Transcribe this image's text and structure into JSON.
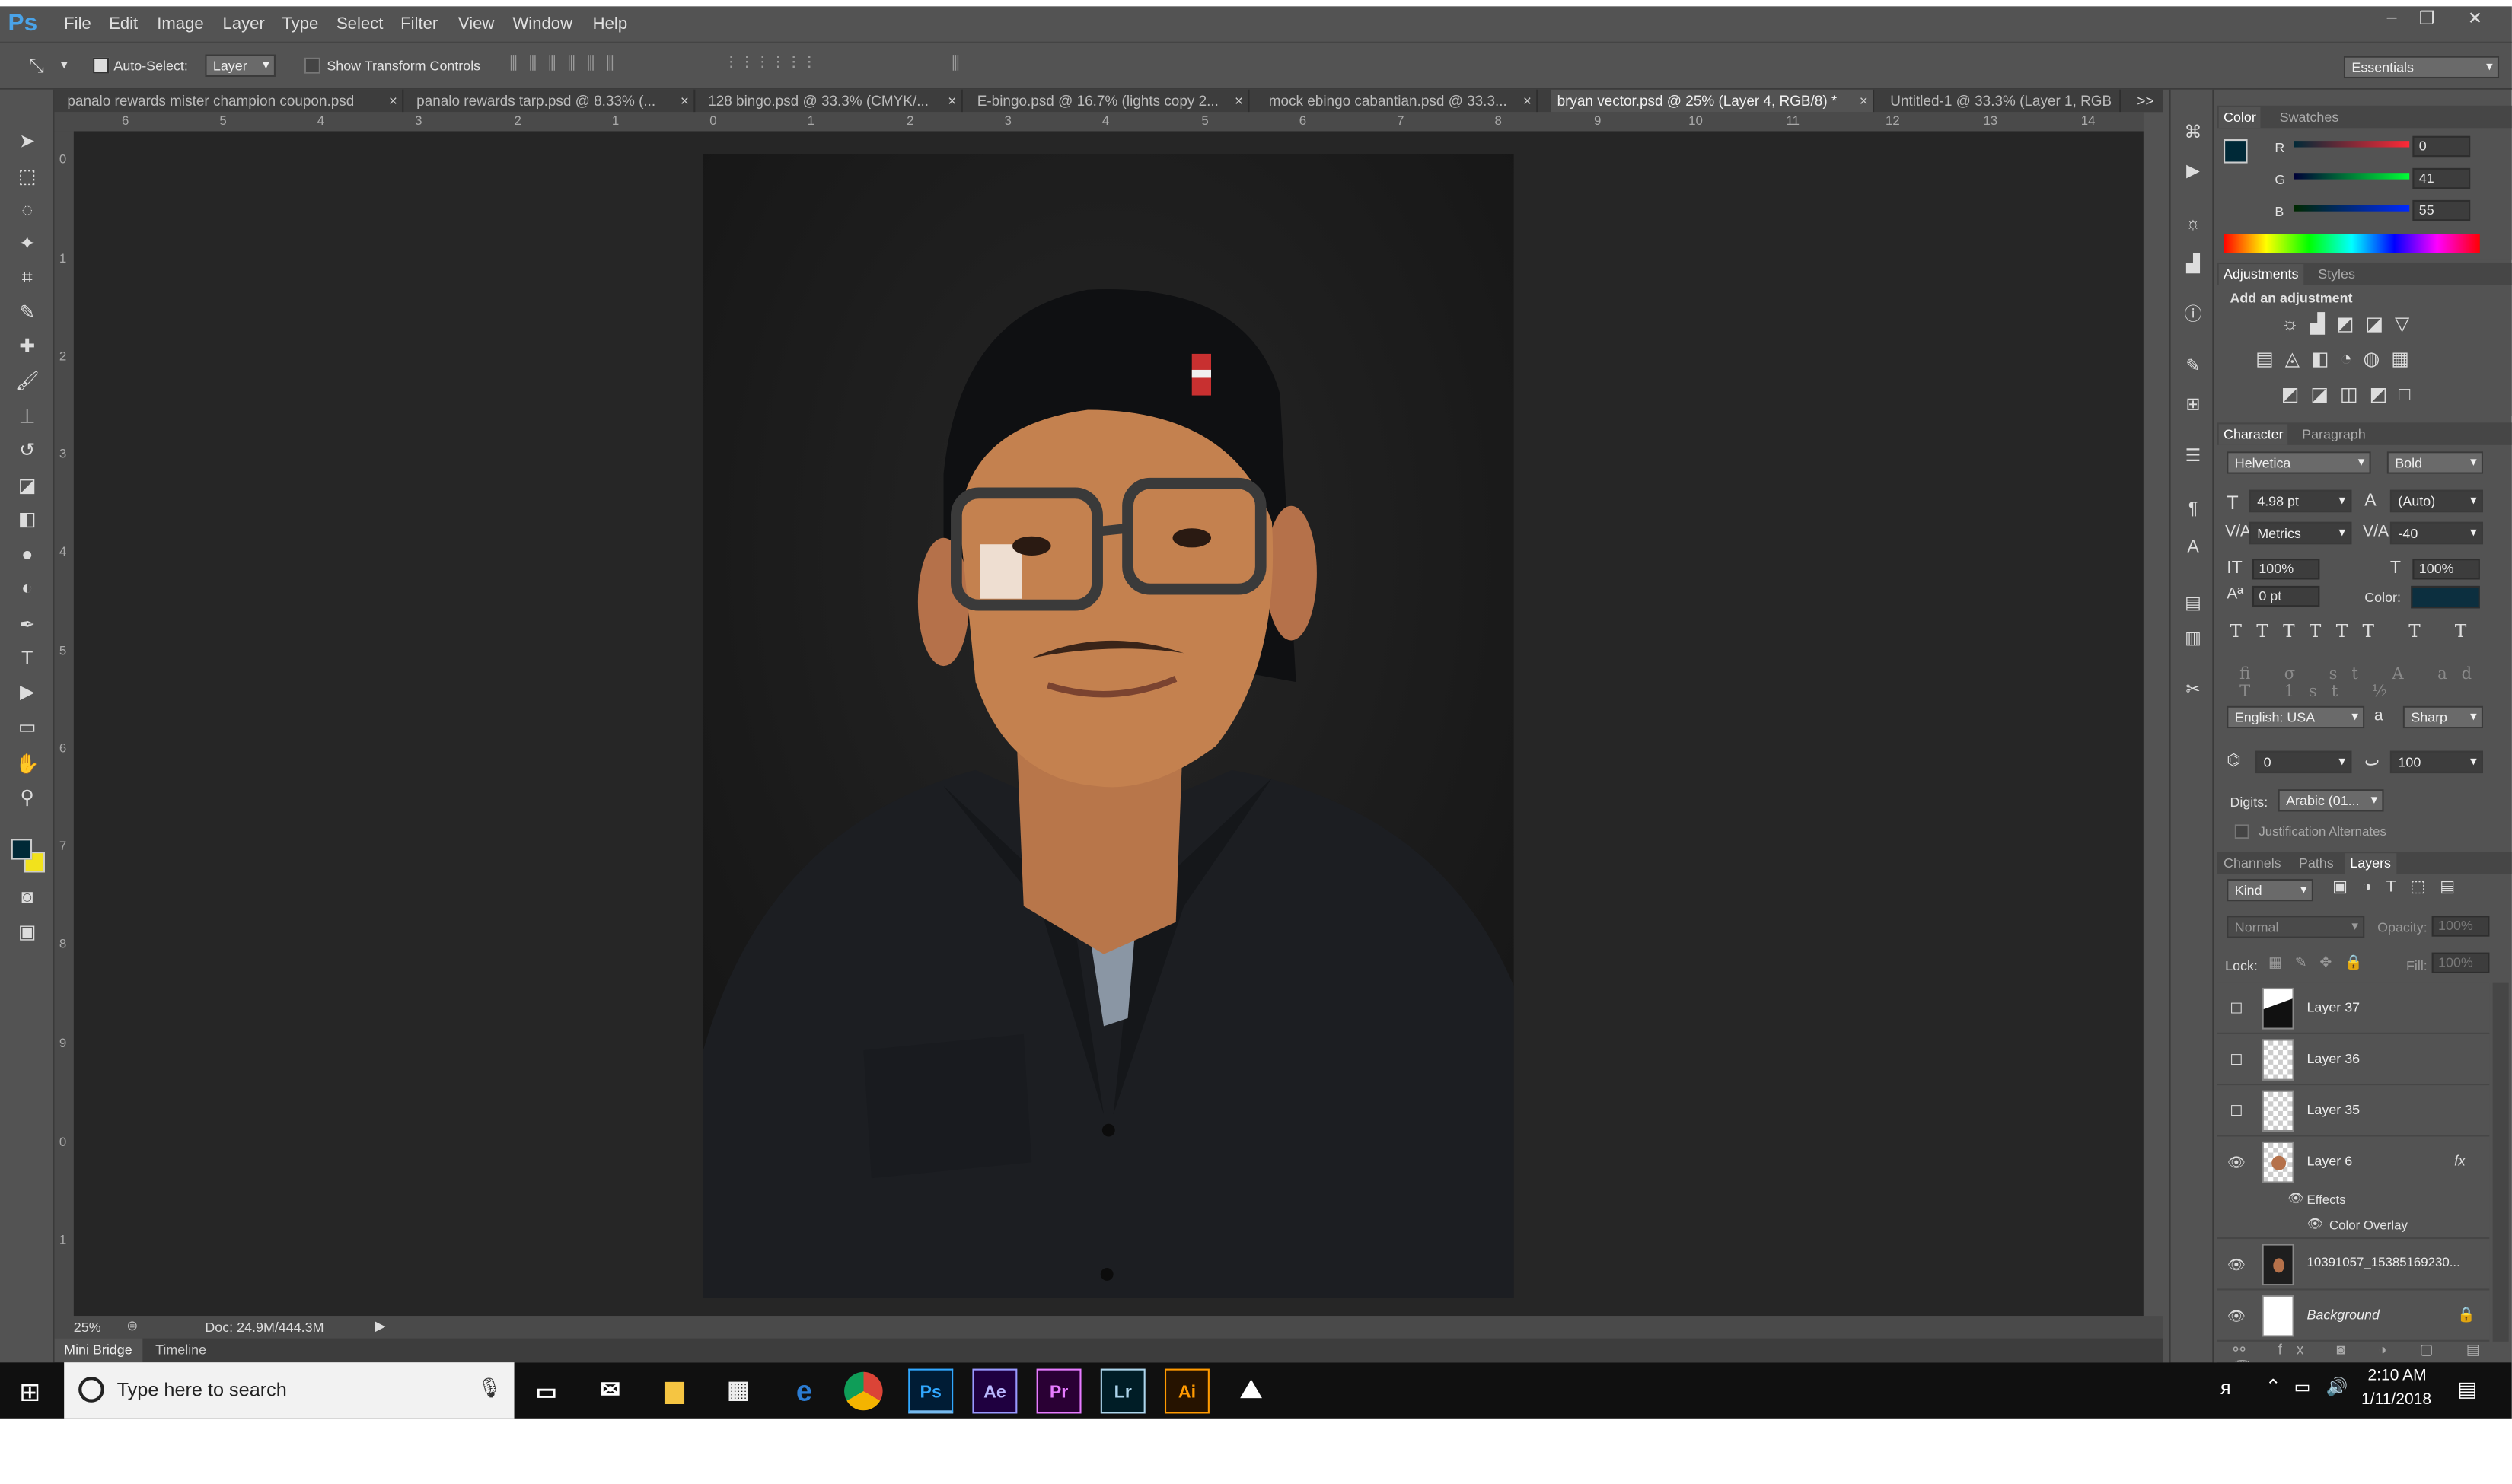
{
  "app": {
    "logo": "Ps"
  },
  "menu": [
    "File",
    "Edit",
    "Image",
    "Layer",
    "Type",
    "Select",
    "Filter",
    "View",
    "Window",
    "Help"
  ],
  "window_controls": {
    "minimize": "–",
    "restore": "❐",
    "close": "✕"
  },
  "options_bar": {
    "auto_select_label": "Auto-Select:",
    "auto_select_value": "Layer",
    "transform_controls_label": "Show Transform Controls",
    "workspace": "Essentials"
  },
  "doc_tabs": [
    "panalo rewards mister champion coupon.psd",
    "panalo rewards tarp.psd @ 8.33% (...",
    "128 bingo.psd @ 33.3% (CMYK/...",
    "E-bingo.psd @ 16.7% (lights copy 2...",
    "mock ebingo cabantian.psd @ 33.3...",
    "bryan vector.psd @ 25% (Layer 4, RGB/8) *",
    "Untitled-1 @ 33.3% (Layer 1, RGB"
  ],
  "close_glyph": "×",
  "tabs_overflow": ">>",
  "ruler_h": [
    "6",
    "5",
    "4",
    "3",
    "2",
    "1",
    "0",
    "1",
    "2",
    "3",
    "4",
    "5",
    "6",
    "7",
    "8",
    "9",
    "10",
    "11",
    "12",
    "13",
    "14"
  ],
  "ruler_v": [
    "0",
    "1",
    "2",
    "3",
    "4",
    "5",
    "6",
    "7",
    "8",
    "9",
    "0",
    "1"
  ],
  "status": {
    "zoom": "25%",
    "doc": "Doc: 24.9M/444.3M"
  },
  "bottom_tabs": [
    "Mini Bridge",
    "Timeline"
  ],
  "color_panel": {
    "tabs": [
      "Color",
      "Swatches"
    ],
    "channels": [
      {
        "label": "R",
        "value": "0"
      },
      {
        "label": "G",
        "value": "41"
      },
      {
        "label": "B",
        "value": "55"
      }
    ],
    "foreground": "#002937",
    "background": "#f2e21c"
  },
  "adjustments": {
    "tabs": [
      "Adjustments",
      "Styles"
    ],
    "title": "Add an adjustment"
  },
  "character": {
    "tabs": [
      "Character",
      "Paragraph"
    ],
    "font_family": "Helvetica",
    "font_style": "Bold",
    "size": "4.98 pt",
    "leading": "(Auto)",
    "kerning": "Metrics",
    "tracking": "-40",
    "vscale": "100%",
    "hscale": "100%",
    "baseline": "0 pt",
    "color_label": "Color:",
    "text_color": "#0c2f3f",
    "language": "English: USA",
    "aa_label": "a",
    "antialias": "Sharp",
    "field_a": "0",
    "field_b": "100",
    "digits_label": "Digits:",
    "digits_value": "Arabic (01...",
    "justification_alternates": "Justification Alternates"
  },
  "layers_panel": {
    "tabs": [
      "Channels",
      "Paths",
      "Layers"
    ],
    "kind": "Kind",
    "blend_mode": "Normal",
    "opacity_label": "Opacity:",
    "opacity_value": "100%",
    "lock_label": "Lock:",
    "fill_label": "Fill:",
    "fill_value": "100%",
    "layers": [
      {
        "name": "Layer 37",
        "visible": false
      },
      {
        "name": "Layer 36",
        "visible": false
      },
      {
        "name": "Layer 35",
        "visible": false
      },
      {
        "name": "Layer 6",
        "visible": true,
        "fx": "fx"
      },
      {
        "name": "10391057_15385169230...",
        "visible": true
      },
      {
        "name": "Background",
        "visible": true
      }
    ],
    "effects_label": "Effects",
    "color_overlay_label": "Color Overlay"
  },
  "taskbar": {
    "search_placeholder": "Type here to search",
    "apps": [
      "Ps",
      "Ae",
      "Pr",
      "Lr",
      "Ai"
    ],
    "time": "2:10 AM",
    "date": "1/11/2018"
  }
}
